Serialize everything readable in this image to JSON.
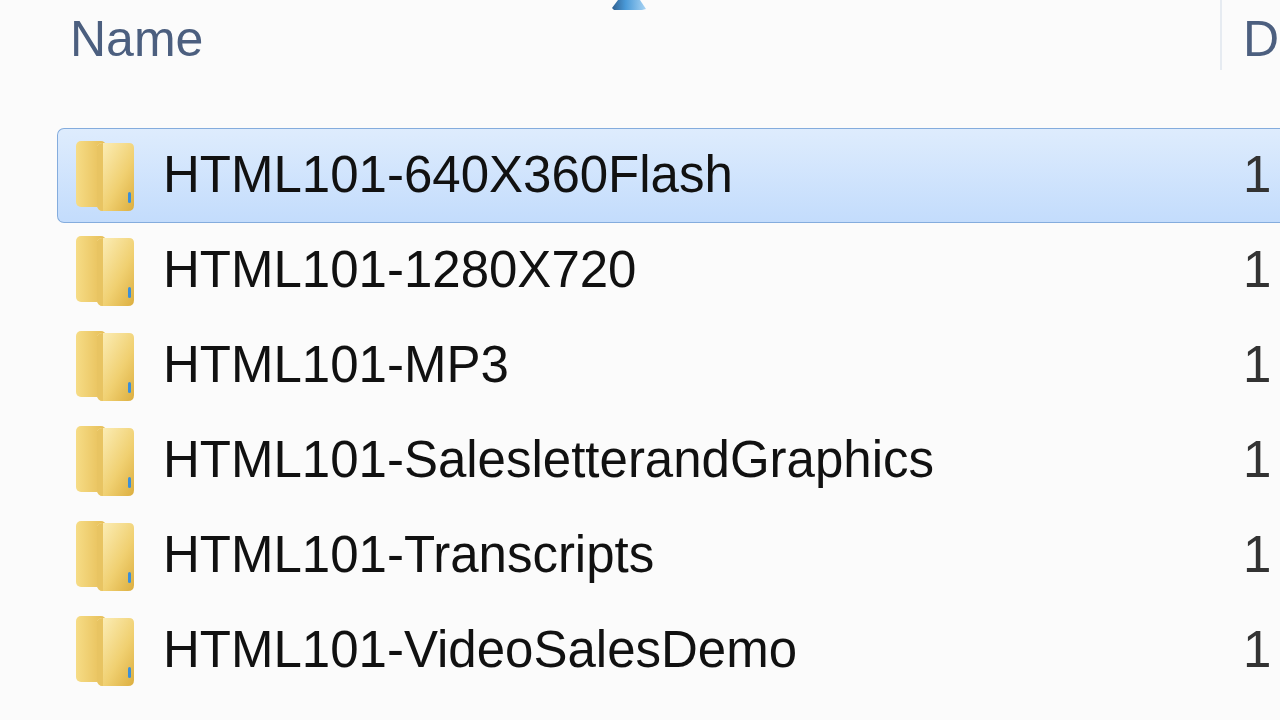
{
  "columns": [
    {
      "label": "Name",
      "sorted": true
    },
    {
      "label": "D"
    }
  ],
  "rows": [
    {
      "name": "HTML101-640X360Flash",
      "column_2": "1",
      "selected": true
    },
    {
      "name": "HTML101-1280X720",
      "column_2": "1",
      "selected": false
    },
    {
      "name": "HTML101-MP3",
      "column_2": "1",
      "selected": false
    },
    {
      "name": "HTML101-SalesletterandGraphics",
      "column_2": "1",
      "selected": false
    },
    {
      "name": "HTML101-Transcripts",
      "column_2": "1",
      "selected": false
    },
    {
      "name": "HTML101-VideoSalesDemo",
      "column_2": "1",
      "selected": false
    }
  ]
}
